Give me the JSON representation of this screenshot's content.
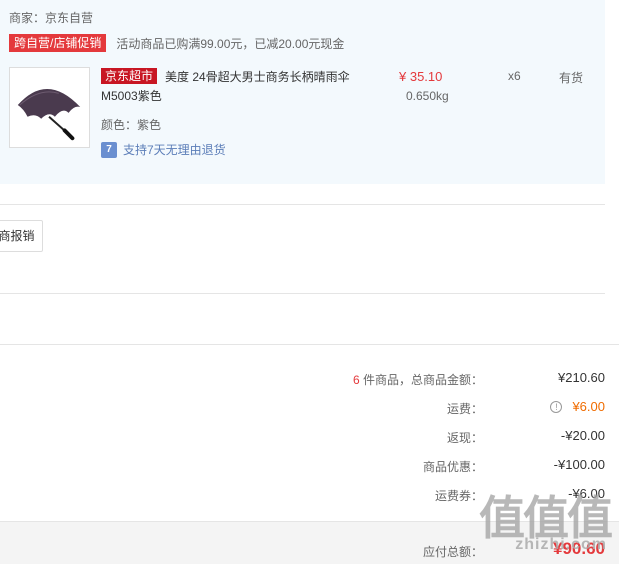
{
  "order": {
    "merchant": "商家：京东自营",
    "promo_tag": "跨自营/店铺促销",
    "promo_text": "活动商品已购满99.00元，已减20.00元现金",
    "product": {
      "image_icon": "umbrella-image",
      "jd_tag": "京东超市",
      "name": "美度 24骨超大男士商务长柄晴雨伞 M5003紫色",
      "color": "颜色：紫色",
      "support_icon": "7-day-return-icon",
      "support_badge": "7",
      "support_text": "支持7天无理由退货",
      "price": "¥ 35.10",
      "weight": "0.650kg",
      "quantity": "x6",
      "stock": "有货"
    }
  },
  "actions": {
    "invoice_button": "商报销"
  },
  "summary": {
    "count": "6",
    "count_label": "件商品，总商品金额：",
    "total": "¥210.60",
    "shipping_label": "运费：",
    "shipping_icon": "info-icon",
    "shipping": "¥6.00",
    "cashback_label": "返现：",
    "cashback": "-¥20.00",
    "discount_label": "商品优惠：",
    "discount": "-¥100.00",
    "shipping_coupon_label": "运费券：",
    "shipping_coupon": "-¥6.00"
  },
  "footer": {
    "pay_label": "应付总额：",
    "pay_total": "¥90.60"
  },
  "watermark": {
    "main": "值值值",
    "sub": "zhizhi.com"
  },
  "colors": {
    "accent_red": "#e4393c",
    "jd_red": "#c81623",
    "shipping_orange": "#f06c00",
    "panel_bg": "#f3f9fd"
  }
}
